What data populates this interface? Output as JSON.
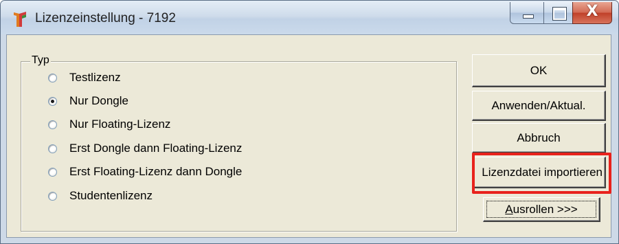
{
  "window": {
    "title": "Lizenzeinstellung - 7192",
    "icon": "app-logo-icon",
    "controls": {
      "minimize": "minimize-icon",
      "maximize": "maximize-icon",
      "close_glyph": "X"
    }
  },
  "group": {
    "legend": "Typ",
    "options": [
      {
        "label": "Testlizenz",
        "checked": false
      },
      {
        "label": "Nur Dongle",
        "checked": true
      },
      {
        "label": "Nur Floating-Lizenz",
        "checked": false
      },
      {
        "label": "Erst Dongle dann Floating-Lizenz",
        "checked": false
      },
      {
        "label": "Erst Floating-Lizenz dann Dongle",
        "checked": false
      },
      {
        "label": "Studentenlizenz",
        "checked": false
      }
    ]
  },
  "buttons": {
    "ok": "OK",
    "apply": "Anwenden/Aktual.",
    "cancel": "Abbruch",
    "import": "Lizenzdatei importieren",
    "expand_mnemonic": "A",
    "expand_rest": "usrollen >>>"
  },
  "highlight_color": "#e8221c"
}
